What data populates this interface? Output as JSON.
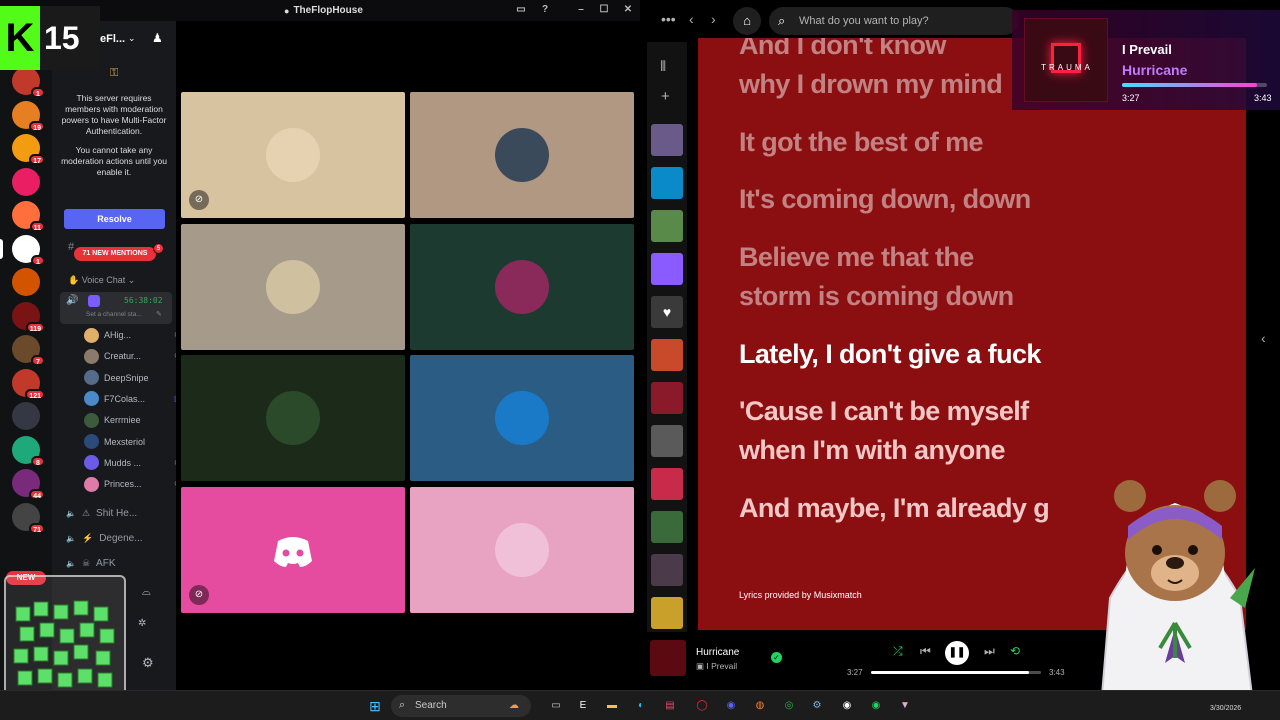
{
  "discord": {
    "window_title": "TheFlopHouse",
    "server_name_partial": "eFl...",
    "mfa_notice_1": "This server requires members with moderation powers to have Multi-Factor Authentication.",
    "mfa_notice_2": "You cannot take any moderation actions until you enable it.",
    "resolve_label": "Resolve",
    "new_mentions": "71 NEW MENTIONS",
    "new_mentions_count": "5",
    "voice_category": "Voice Chat",
    "call_timer": "56:38:02",
    "channel_status_placeholder": "Set a channel sta...",
    "new_label": "NEW",
    "server_badges": [
      "1",
      "19",
      "17",
      "",
      "11",
      "1",
      "",
      "119",
      "7",
      "121",
      "",
      "8",
      "44",
      "71"
    ],
    "members": [
      {
        "name": "AHig...",
        "icon": "mute-deafen-icon"
      },
      {
        "name": "Creatur...",
        "icon": "video-off-icon"
      },
      {
        "name": "DeepSnipe",
        "icon": ""
      },
      {
        "name": "F7Colas...",
        "icon": "streaming-icon"
      },
      {
        "name": "Kerrmiee",
        "icon": ""
      },
      {
        "name": "Mexsteriol",
        "icon": ""
      },
      {
        "name": "Mudds ...",
        "icon": "mute-icon"
      },
      {
        "name": "Princes...",
        "icon": "video-off-icon"
      }
    ],
    "channels": [
      {
        "name": "Shit He..."
      },
      {
        "name": "Degene..."
      },
      {
        "name": "AFK"
      }
    ],
    "tiles": [
      {
        "bg": "#d8c3a0",
        "muted": true
      },
      {
        "bg": "#b09882",
        "muted": false
      },
      {
        "bg": "#a69a8a",
        "muted": false
      },
      {
        "bg": "#1d3a30",
        "muted": false
      },
      {
        "bg": "#1c2a1a",
        "muted": false
      },
      {
        "bg": "#2b5c84",
        "muted": false
      },
      {
        "bg": "#e54ca0",
        "muted": true
      },
      {
        "bg": "#e8a2c2",
        "muted": false
      }
    ]
  },
  "kick": {
    "logo": "K",
    "count": "15"
  },
  "spotify": {
    "search_placeholder": "What do you want to play?",
    "lyrics": {
      "past": [
        "And I don't know",
        "why I drown my mind",
        "It got the best of me",
        "It's coming down, down",
        "Believe me that the",
        "storm is coming down"
      ],
      "active": "Lately, I don't give a fuck",
      "future": [
        "'Cause I can't be myself",
        "when I'm with anyone",
        "And maybe, I'm already g"
      ]
    },
    "lyrics_credit": "Lyrics provided by Musixmatch",
    "now_playing": {
      "title": "Hurricane",
      "artist": "I Prevail",
      "elapsed": "3:27",
      "total": "3:43",
      "progress": 0.93
    }
  },
  "overlay": {
    "artist": "I Prevail",
    "title": "Hurricane",
    "art_text": "TRAUMA",
    "art_band": "I PREVAIL",
    "elapsed": "3:27",
    "total": "3:43",
    "progress": 0.93
  },
  "taskbar": {
    "search_label": "Search",
    "date": "3/30/2026"
  },
  "colors": {
    "discord_bg": "#18191c",
    "discord_blurple": "#5865f2",
    "discord_red": "#e8323b",
    "spotify_green": "#1ed760",
    "lyrics_bg": "#8b0f10",
    "kick_green": "#53fc18"
  }
}
